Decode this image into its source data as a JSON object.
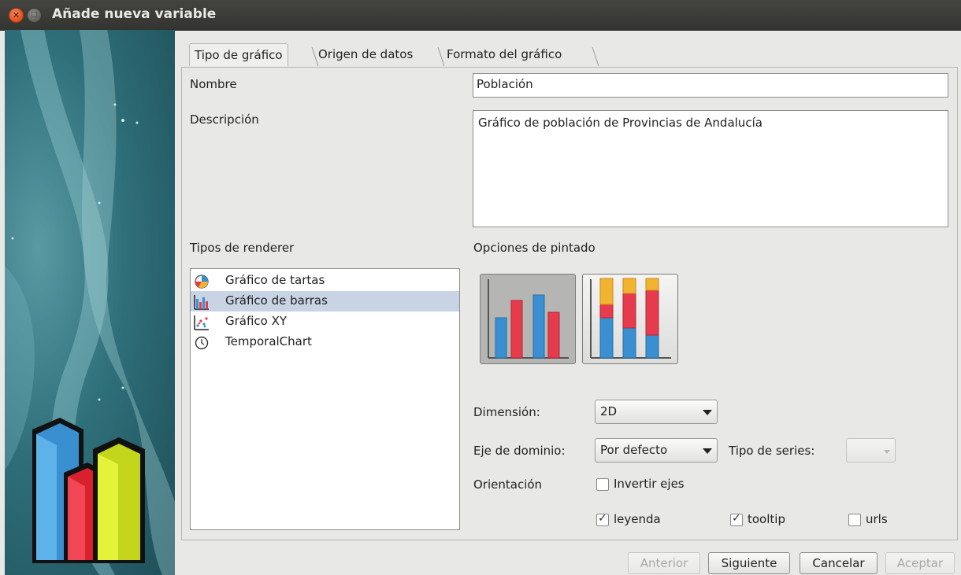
{
  "window": {
    "title": "Añade nueva variable"
  },
  "tabs": [
    {
      "label": "Tipo de gráfico"
    },
    {
      "label": "Origen de datos"
    },
    {
      "label": "Formato del gráfico"
    }
  ],
  "form": {
    "nombre_label": "Nombre",
    "nombre_value": "Población",
    "descripcion_label": "Descripción",
    "descripcion_value": "Gráfico de población de Provincias de Andalucía",
    "tipos_label": "Tipos de renderer",
    "opciones_label": "Opciones de pintado"
  },
  "renderers": [
    {
      "label": "Gráfico de tartas",
      "icon": "pie-chart-icon"
    },
    {
      "label": "Gráfico de barras",
      "icon": "bar-chart-icon",
      "selected": true
    },
    {
      "label": "Gráfico XY",
      "icon": "xy-chart-icon"
    },
    {
      "label": "TemporalChart",
      "icon": "clock-icon"
    }
  ],
  "options": {
    "dimension_label": "Dimensión:",
    "dimension_value": "2D",
    "eje_label": "Eje de dominio:",
    "eje_value": "Por defecto",
    "tipo_series_label": "Tipo de series:",
    "tipo_series_value": "",
    "orientacion_label": "Orientación",
    "invertir_label": "Invertir ejes",
    "invertir_checked": false,
    "leyenda_label": "leyenda",
    "leyenda_checked": true,
    "tooltip_label": "tooltip",
    "tooltip_checked": true,
    "urls_label": "urls",
    "urls_checked": false
  },
  "buttons": {
    "anterior": "Anterior",
    "siguiente": "Siguiente",
    "cancelar": "Cancelar",
    "aceptar": "Aceptar"
  },
  "colors": {
    "bar_blue": "#3a8fd0",
    "bar_red": "#e53b4c",
    "bar_yellow": "#f2b430",
    "bar_lime": "#d8ea2a"
  }
}
